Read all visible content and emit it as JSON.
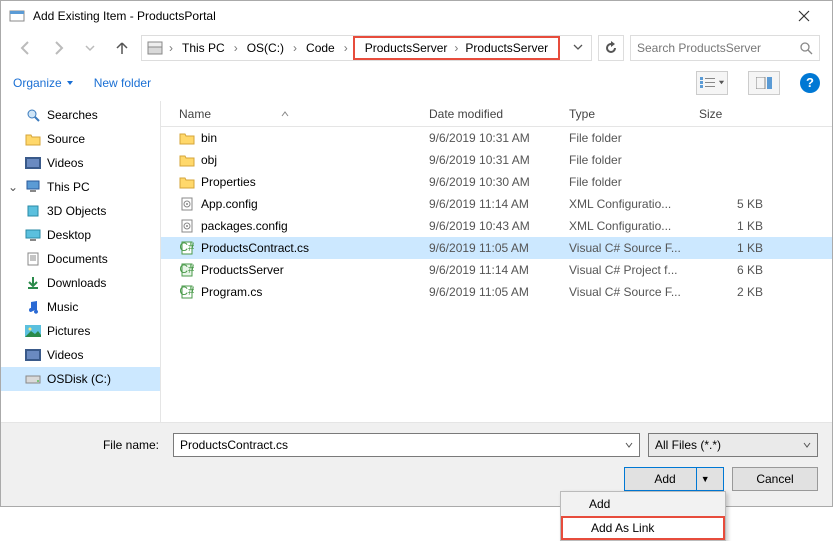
{
  "window": {
    "title": "Add Existing Item - ProductsPortal"
  },
  "breadcrumb": {
    "parts": [
      "This PC",
      "OS(C:)",
      "Code",
      "ProductsServer",
      "ProductsServer"
    ]
  },
  "search": {
    "placeholder": "Search ProductsServer"
  },
  "toolbar": {
    "organize": "Organize",
    "newfolder": "New folder"
  },
  "tree": {
    "items": [
      {
        "label": "Searches",
        "icon": "search"
      },
      {
        "label": "Source",
        "icon": "folder"
      },
      {
        "label": "Videos",
        "icon": "videos"
      }
    ],
    "thispc": "This PC",
    "pc_items": [
      {
        "label": "3D Objects",
        "icon": "3d"
      },
      {
        "label": "Desktop",
        "icon": "desktop"
      },
      {
        "label": "Documents",
        "icon": "documents"
      },
      {
        "label": "Downloads",
        "icon": "downloads"
      },
      {
        "label": "Music",
        "icon": "music"
      },
      {
        "label": "Pictures",
        "icon": "pictures"
      },
      {
        "label": "Videos",
        "icon": "videos"
      },
      {
        "label": "OSDisk (C:)",
        "icon": "drive",
        "selected": true
      }
    ]
  },
  "columns": {
    "name": "Name",
    "date": "Date modified",
    "type": "Type",
    "size": "Size"
  },
  "files": [
    {
      "name": "bin",
      "date": "9/6/2019 10:31 AM",
      "type": "File folder",
      "size": "",
      "icon": "folder"
    },
    {
      "name": "obj",
      "date": "9/6/2019 10:31 AM",
      "type": "File folder",
      "size": "",
      "icon": "folder"
    },
    {
      "name": "Properties",
      "date": "9/6/2019 10:30 AM",
      "type": "File folder",
      "size": "",
      "icon": "folder"
    },
    {
      "name": "App.config",
      "date": "9/6/2019 11:14 AM",
      "type": "XML Configuratio...",
      "size": "5 KB",
      "icon": "config"
    },
    {
      "name": "packages.config",
      "date": "9/6/2019 10:43 AM",
      "type": "XML Configuratio...",
      "size": "1 KB",
      "icon": "config"
    },
    {
      "name": "ProductsContract.cs",
      "date": "9/6/2019 11:05 AM",
      "type": "Visual C# Source F...",
      "size": "1 KB",
      "icon": "cs",
      "selected": true
    },
    {
      "name": "ProductsServer",
      "date": "9/6/2019 11:14 AM",
      "type": "Visual C# Project f...",
      "size": "6 KB",
      "icon": "csproj"
    },
    {
      "name": "Program.cs",
      "date": "9/6/2019 11:05 AM",
      "type": "Visual C# Source F...",
      "size": "2 KB",
      "icon": "cs"
    }
  ],
  "footer": {
    "filename_label": "File name:",
    "filename_value": "ProductsContract.cs",
    "filter": "All Files (*.*)",
    "add": "Add",
    "cancel": "Cancel"
  },
  "dropdown": {
    "add": "Add",
    "addaslink": "Add As Link"
  }
}
